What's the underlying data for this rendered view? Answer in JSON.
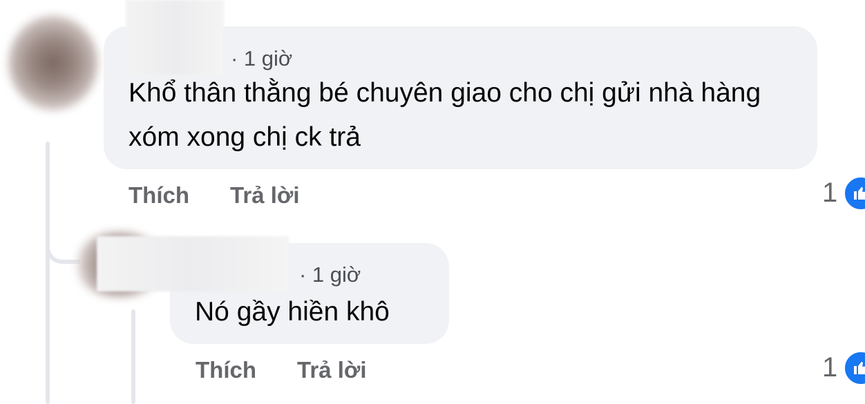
{
  "comments": [
    {
      "author_redacted": "",
      "time": "· 1 giờ",
      "text": "Khổ thân thằng bé chuyên giao cho chị gửi nhà hàng xóm xong chị ck trả",
      "actions": {
        "like": "Thích",
        "reply": "Trả lời"
      },
      "reaction_count": "1",
      "reaction_icon": "like-icon"
    },
    {
      "author_redacted": "",
      "time": "· 1 giờ",
      "text": "Nó gầy hiền khô",
      "actions": {
        "like": "Thích",
        "reply": "Trả lời"
      },
      "reaction_count": "1",
      "reaction_icon": "like-icon"
    }
  ],
  "colors": {
    "bubble_background": "#f0f2f5",
    "action_text": "#65676b",
    "like_badge": "#1877f2",
    "thread_line": "#e4e6eb"
  }
}
